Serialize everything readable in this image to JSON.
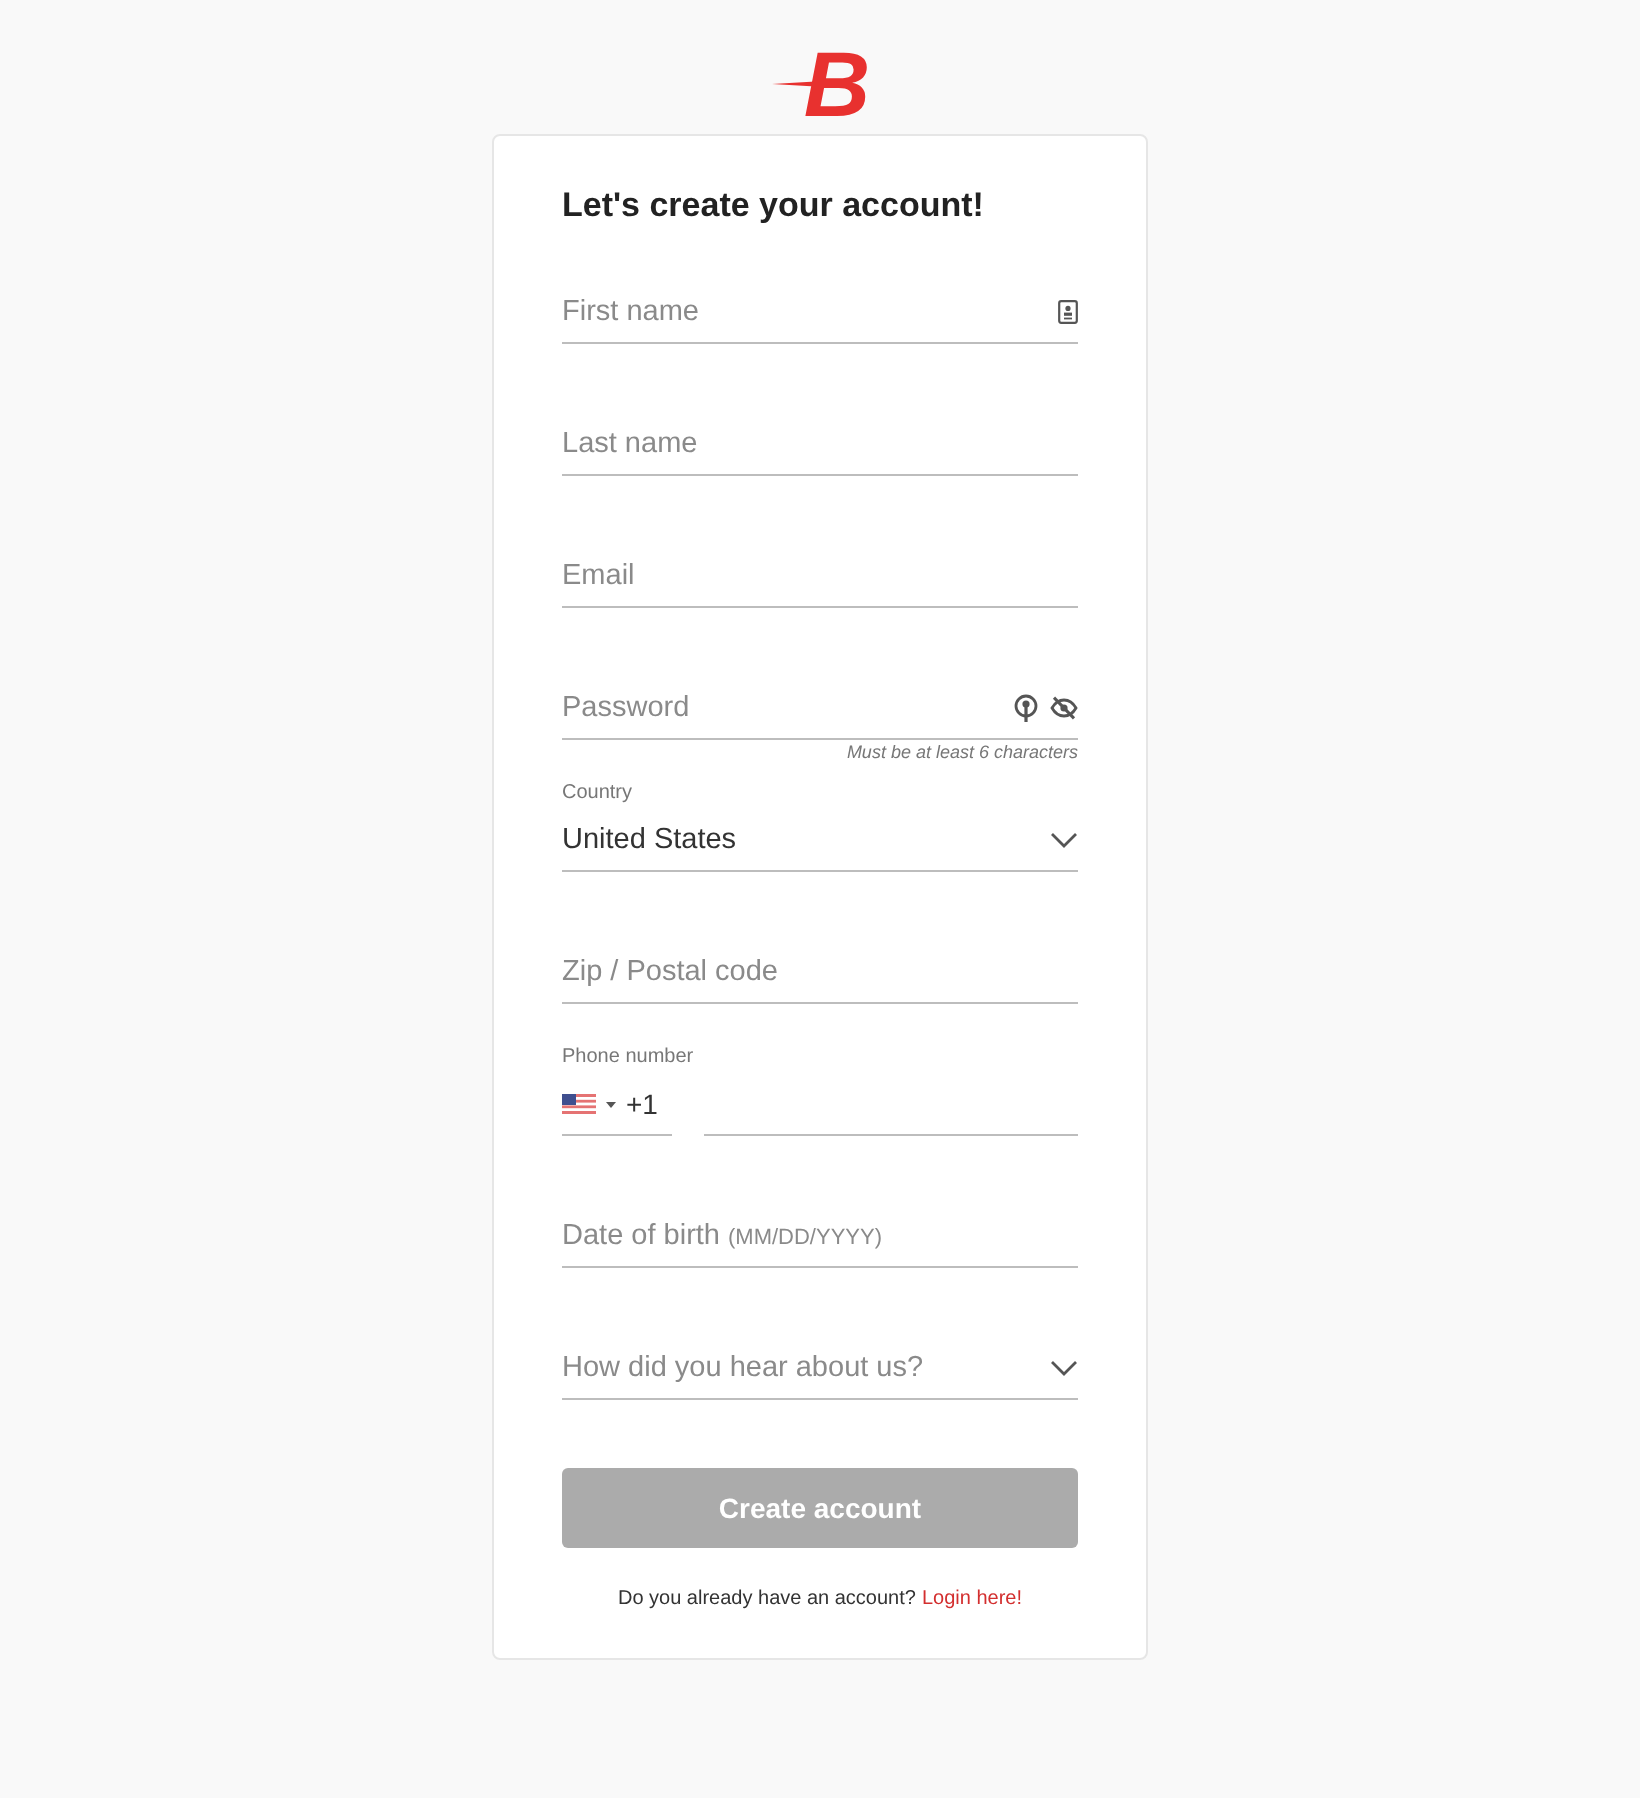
{
  "logo": "B",
  "title": "Let's create your account!",
  "fields": [
    {
      "kind": "text",
      "placeholder": "First name",
      "contact_icon": true
    },
    {
      "kind": "text",
      "placeholder": "Last name",
      "contact_icon": false
    },
    {
      "kind": "text",
      "placeholder": "Email",
      "contact_icon": false
    },
    {
      "kind": "password",
      "placeholder": "Password",
      "hint": "Must be at least 6 characters"
    },
    {
      "kind": "select",
      "label": "Country",
      "value": "United States"
    },
    {
      "kind": "text",
      "placeholder": "Zip / Postal code",
      "contact_icon": false
    },
    {
      "kind": "phone",
      "label": "Phone number",
      "code": "+1"
    },
    {
      "kind": "date",
      "placeholder": "Date of birth",
      "format": "(MM/DD/YYYY)"
    },
    {
      "kind": "select",
      "placeholder": "How did you hear about us?"
    }
  ],
  "submit": {
    "label": "Create account",
    "disabled": true
  },
  "footer": {
    "text": "Do you already have an account?",
    "link": "Login here!"
  }
}
